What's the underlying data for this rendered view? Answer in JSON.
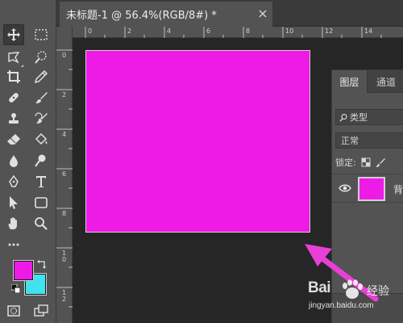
{
  "document": {
    "tab_title": "未标题-1 @ 56.4%(RGB/8#) *",
    "canvas_color": "#ee1be7"
  },
  "colors": {
    "foreground": "#ee1be7",
    "background": "#3fe3f0",
    "annotation_arrow": "#e83fd6"
  },
  "toolbar": {
    "tools": [
      "move-icon",
      "marquee-icon",
      "lasso-icon",
      "quick-select-icon",
      "crop-icon",
      "eyedropper-icon",
      "healing-brush-icon",
      "brush-icon",
      "clone-stamp-icon",
      "history-brush-icon",
      "eraser-icon",
      "paint-bucket-icon",
      "blur-icon",
      "dodge-icon",
      "pen-icon",
      "type-icon",
      "path-select-icon",
      "shape-icon",
      "hand-icon",
      "zoom-icon",
      "more-tools-icon",
      "quick-mask-icon",
      "screen-mode-icon"
    ]
  },
  "rulers": {
    "top": [
      "0",
      "2",
      "4",
      "6",
      "8",
      "10",
      "12",
      "14"
    ],
    "left": [
      "0",
      "2",
      "4",
      "6",
      "8",
      "1\n0",
      "1\n2"
    ]
  },
  "layers_panel": {
    "tabs": [
      "图层",
      "通道"
    ],
    "filter_label": "类型",
    "blend_mode": "正常",
    "lock_label": "锁定:",
    "layer_name": "背"
  },
  "watermark": {
    "brand": "Bai",
    "suffix": "经验",
    "url": "jingyan.baidu.com"
  }
}
